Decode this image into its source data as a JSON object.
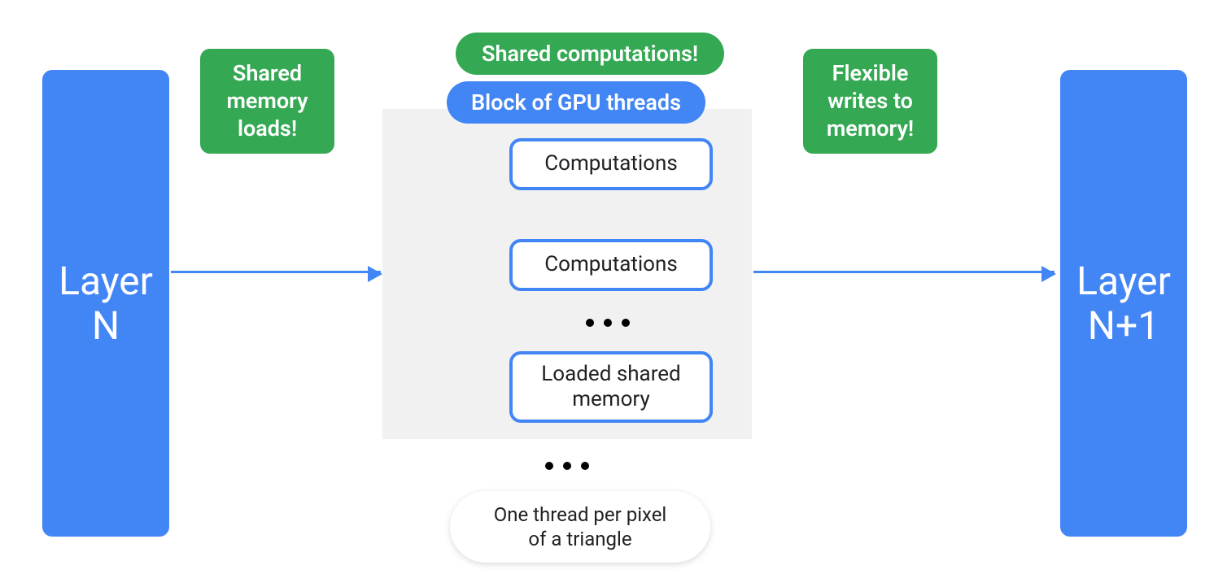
{
  "colors": {
    "blue": "#4285F4",
    "green": "#34A853",
    "gray": "#F1F1F1",
    "text": "#202124"
  },
  "layer_left": {
    "line1": "Layer",
    "line2": "N"
  },
  "layer_right": {
    "line1": "Layer",
    "line2": "N+1"
  },
  "callout_left": {
    "line1": "Shared",
    "line2": "memory",
    "line3": "loads!"
  },
  "callout_right": {
    "line1": "Flexible",
    "line2": "writes to",
    "line3": "memory!"
  },
  "pill_shared_comp": "Shared computations!",
  "pill_block_threads": "Block of GPU threads",
  "comp1": "Computations",
  "comp2": "Computations",
  "comp_shared": {
    "line1": "Loaded shared",
    "line2": "memory"
  },
  "thread_pill": {
    "line1": "One thread per pixel",
    "line2": "of a triangle"
  }
}
